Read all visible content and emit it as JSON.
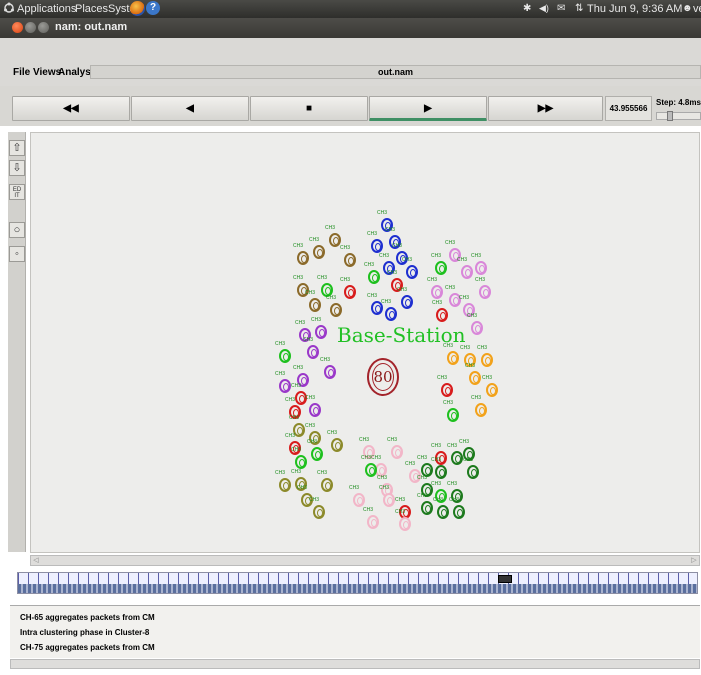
{
  "panel": {
    "applications": "Applications",
    "places": "Places",
    "system": "System",
    "clock": "Thu Jun 9, 9:36 AM",
    "user": "veeru",
    "icons": [
      "ubuntu-logo-icon",
      "firefox-icon",
      "help-icon",
      "bluetooth-icon",
      "volume-icon",
      "mail-icon",
      "network-icon",
      "user-icon"
    ]
  },
  "window": {
    "title": "nam: out.nam"
  },
  "menubar": {
    "file": "File",
    "views": "Views",
    "analysis": "Analysis",
    "filename": "out.nam"
  },
  "controls": {
    "rewind": "◀◀",
    "back": "◀",
    "stop": "■",
    "play": "▶",
    "fast_forward": "▶▶",
    "time": "43.955566",
    "step": "Step: 4.8ms"
  },
  "canvas": {
    "title": "Base-Station",
    "base_node": "80",
    "node_label": "CH3"
  },
  "log": {
    "lines": [
      "CH-65 aggregates packets from CM",
      "Intra clustering phase in Cluster-8",
      "CH-75 aggregates packets from CM"
    ]
  },
  "colors": {
    "brown": "#8b6a2a",
    "blue": "#1e2fd0",
    "pink": "#d987d9",
    "purple": "#9a38c9",
    "orange": "#f2a21a",
    "olive": "#8c8a2a",
    "lightpink": "#f2b6c8",
    "darkgreen": "#1d7a1d",
    "green": "#1ec01e",
    "red": "#d81c1c"
  }
}
